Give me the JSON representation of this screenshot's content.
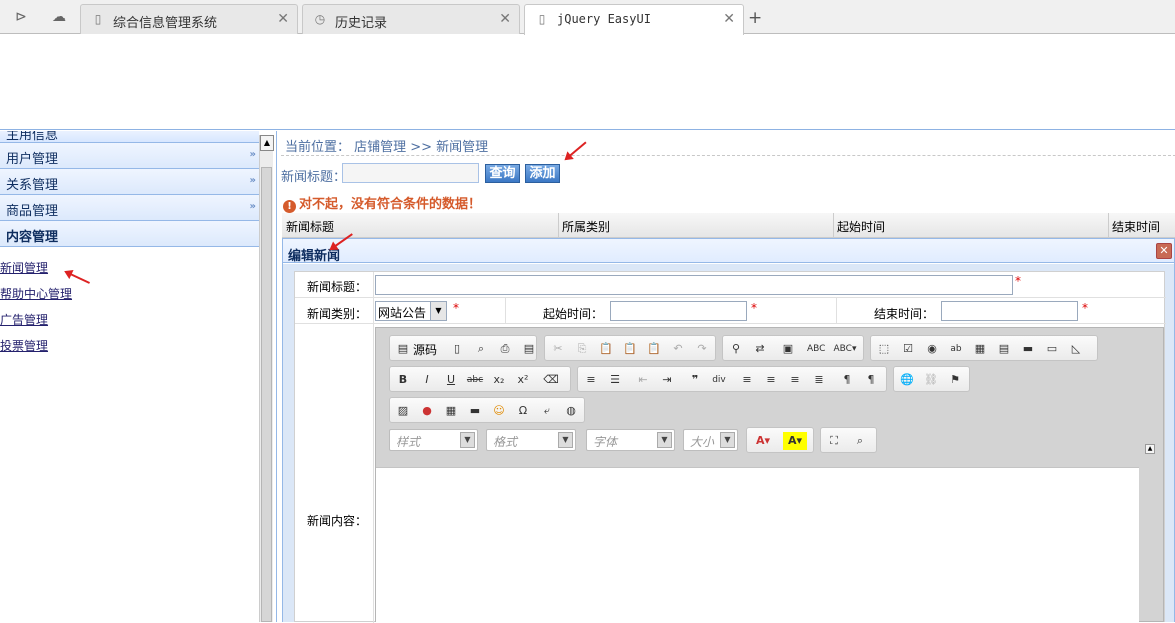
{
  "browser": {
    "tabs": [
      {
        "title": "综合信息管理系统",
        "icon": "page-icon"
      },
      {
        "title": "历史记录",
        "icon": "history-clock-icon"
      },
      {
        "title": "jQuery EasyUI",
        "icon": "page-icon"
      }
    ],
    "active_tab": 2,
    "new_tab_label": "+"
  },
  "sidebar": {
    "partial_item": "主用信息",
    "items": [
      {
        "label": "用户管理"
      },
      {
        "label": "关系管理"
      },
      {
        "label": "商品管理"
      },
      {
        "label": "内容管理"
      }
    ],
    "sub_links": [
      "新闻管理",
      "帮助中心管理",
      "广告管理",
      "投票管理"
    ]
  },
  "main": {
    "breadcrumb": "当前位置： 店铺管理 >> 新闻管理",
    "search_label": "新闻标题：",
    "search_value": "",
    "query_button": "查询",
    "add_button": "添加",
    "notice": "对不起，没有符合条件的数据！",
    "grid_columns": [
      "新闻标题",
      "所属类别",
      "起始时间",
      "结束时间"
    ]
  },
  "dialog": {
    "title": "编辑新闻",
    "fields": {
      "title_label": "新闻标题：",
      "category_label": "新闻类别：",
      "category_value": "网站公告",
      "start_label": "起始时间：",
      "end_label": "结束时间：",
      "content_label": "新闻内容：",
      "required_mark": "*"
    },
    "editor": {
      "source_label": "源码",
      "combos": [
        "样式",
        "格式",
        "字体",
        "大小"
      ]
    }
  },
  "colors": {
    "accent": "#95b8e7",
    "notice": "#d55b2c",
    "button": "#3b78c5"
  }
}
